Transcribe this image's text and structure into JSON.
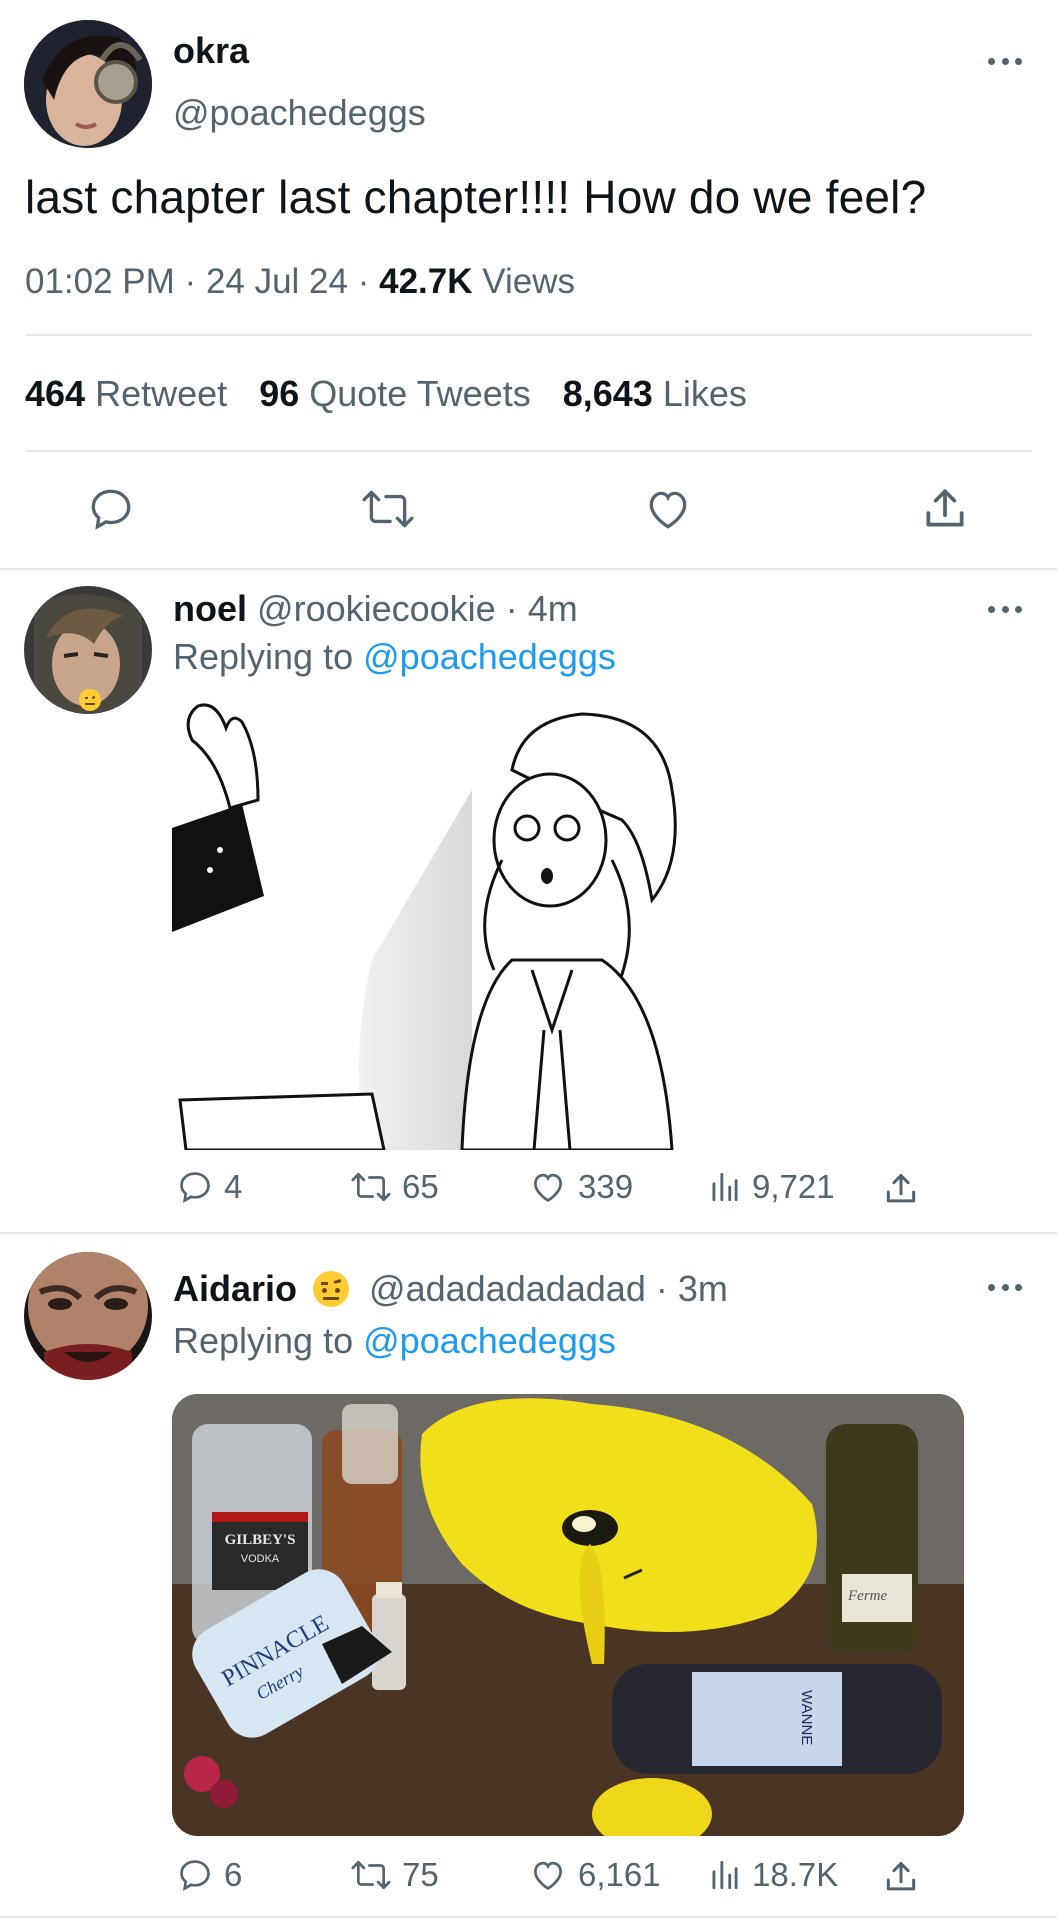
{
  "main_tweet": {
    "display_name": "okra",
    "handle": "@poachedeggs",
    "text": "last chapter last chapter!!!! How do we feel?",
    "time": "01:02 PM",
    "date": "24 Jul 24",
    "views_count": "42.7K",
    "views_label": "Views",
    "separator": "·",
    "stats": {
      "retweets_count": "464",
      "retweets_label": "Retweet",
      "quotes_count": "96",
      "quotes_label": "Quote Tweets",
      "likes_count": "8,643",
      "likes_label": "Likes"
    }
  },
  "replies": [
    {
      "display_name": "noel",
      "handle": "@rookiecookie",
      "age": "· 4m",
      "replying_prefix": "Replying to",
      "replying_to": "@poachedeggs",
      "replies": "4",
      "retweets": "65",
      "likes": "339",
      "views": "9,721"
    },
    {
      "display_name": "Aidario",
      "emoji": "🤨",
      "handle": "@adadadadadad",
      "age": "· 3m",
      "replying_prefix": "Replying to",
      "replying_to": "@poachedeggs",
      "image_texts": [
        "GILBEY'S",
        "VODKA",
        "PINNACLE",
        "Cherry",
        "Ferme",
        "WANNE"
      ],
      "replies": "6",
      "retweets": "75",
      "likes": "6,161",
      "views": "18.7K"
    }
  ],
  "icons": [
    "more-icon",
    "reply-icon",
    "retweet-icon",
    "like-icon",
    "share-icon",
    "views-icon"
  ],
  "colors": {
    "link": "#1d9bf0",
    "muted": "#536471",
    "text": "#0f1419",
    "divider": "#e6e9ec"
  }
}
